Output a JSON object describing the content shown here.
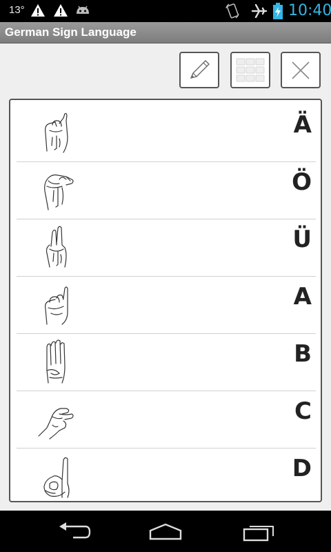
{
  "status_bar": {
    "temperature": "13°",
    "time": "10:40"
  },
  "app": {
    "title": "German Sign Language"
  },
  "toolbar": {
    "edit_icon": "pencil-icon",
    "grid_icon": "grid-icon",
    "close_icon": "close-icon"
  },
  "letters": [
    {
      "letter": "Ä",
      "icon": "hand-sign-ae"
    },
    {
      "letter": "Ö",
      "icon": "hand-sign-oe"
    },
    {
      "letter": "Ü",
      "icon": "hand-sign-ue"
    },
    {
      "letter": "A",
      "icon": "hand-sign-a"
    },
    {
      "letter": "B",
      "icon": "hand-sign-b"
    },
    {
      "letter": "C",
      "icon": "hand-sign-c"
    },
    {
      "letter": "D",
      "icon": "hand-sign-d"
    }
  ],
  "colors": {
    "clock": "#33b5e5",
    "title_bar": "#8a8a8a",
    "background": "#efefef"
  }
}
